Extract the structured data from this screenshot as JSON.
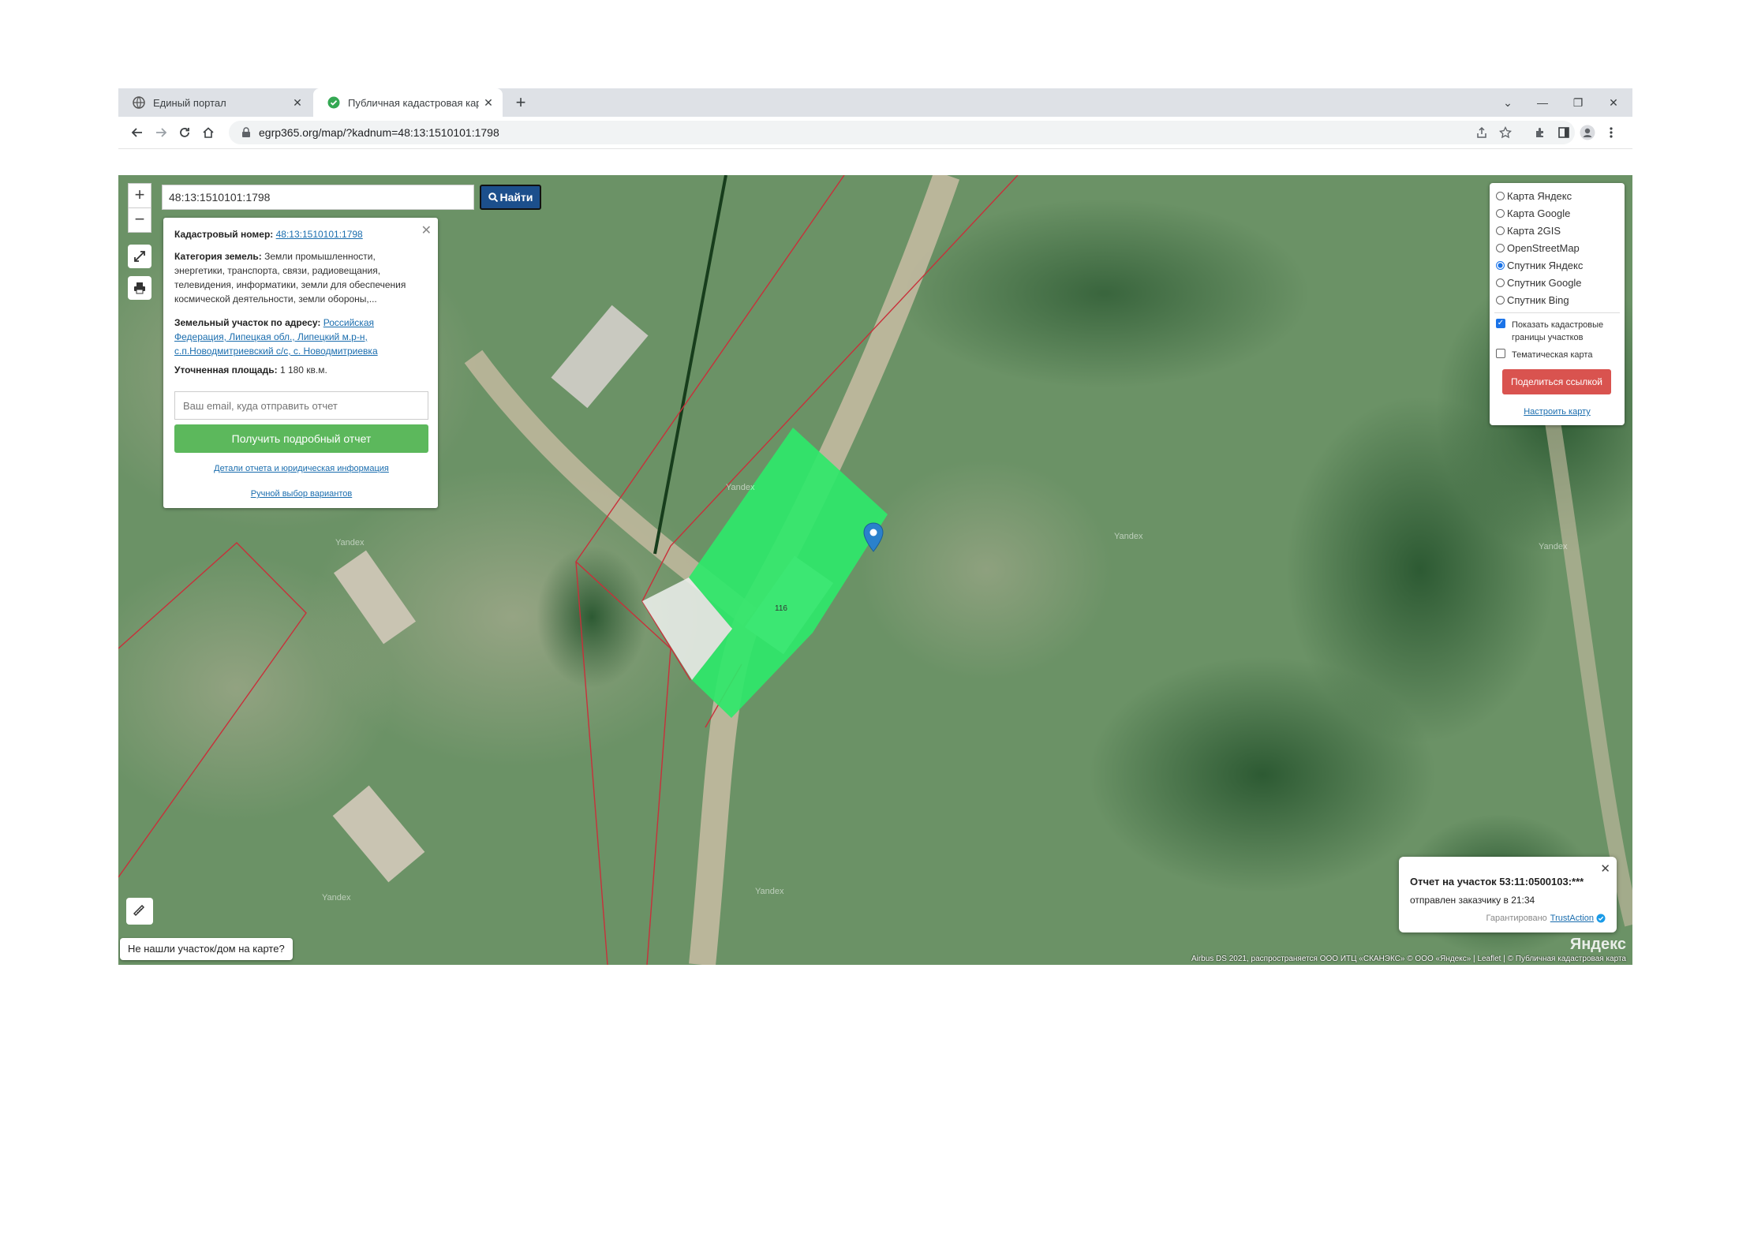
{
  "browser": {
    "tabs": [
      {
        "label": "Единый портал",
        "active": false
      },
      {
        "label": "Публичная кадастровая карта -",
        "active": true
      }
    ],
    "url": "egrp365.org/map/?kadnum=48:13:1510101:1798"
  },
  "map": {
    "search": {
      "value": "48:13:1510101:1798",
      "button_label": "Найти"
    },
    "info_panel": {
      "cadastral_label": "Кадастровый номер:",
      "cadastral_number": "48:13:1510101:1798",
      "category_label": "Категория земель:",
      "category_text": "Земли промышленности, энергетики, транспорта, связи, радиовещания, телевидения, информатики, земли для обеспечения космической деятельности, земли обороны,...",
      "address_label": "Земельный участок по адресу:",
      "address_text": "Российская Федерация, Липецкая обл., Липецкий м.р-н, с.п.Новодмитриевский с/с, с. Новодмитриевка",
      "area_label": "Уточненная площадь:",
      "area_value": "1 180 кв.м.",
      "email_placeholder": "Ваш email, куда отправить отчет",
      "report_button": "Получить подробный отчет",
      "details_link": "Детали отчета и юридическая информация",
      "manual_link": "Ручной выбор вариантов"
    },
    "layers": {
      "options": [
        {
          "label": "Карта Яндекс",
          "selected": false
        },
        {
          "label": "Карта Google",
          "selected": false
        },
        {
          "label": "Карта 2GIS",
          "selected": false
        },
        {
          "label": "OpenStreetMap",
          "selected": false
        },
        {
          "label": "Спутник Яндекс",
          "selected": true
        },
        {
          "label": "Спутник Google",
          "selected": false
        },
        {
          "label": "Спутник Bing",
          "selected": false
        }
      ],
      "show_boundaries": "Показать кадастровые границы участков",
      "thematic": "Тематическая карта",
      "share_button": "Поделиться ссылкой",
      "configure_link": "Настроить карту"
    },
    "toast": {
      "title": "Отчет на участок 53:11:0500103:***",
      "subtitle": "отправлен заказчику в 21:34",
      "guarantee": "Гарантировано",
      "guarantee_link": "TrustAction"
    },
    "not_found": "Не нашли участок/дом на карте?",
    "plot_label": "116",
    "watermark": "Yandex",
    "yandex_logo": "Яндекс",
    "attribution": "Airbus DS 2021, распространяется ООО ИТЦ «СКАНЭКС» © ООО «Яндекс» | Leaflet | © Публичная кадастровая карта",
    "colors": {
      "highlight": "#2fe86a",
      "boundary": "#c8303a",
      "report_button": "#5cb85c",
      "share_button": "#d9534f",
      "search_button": "#1c4f8c"
    }
  }
}
